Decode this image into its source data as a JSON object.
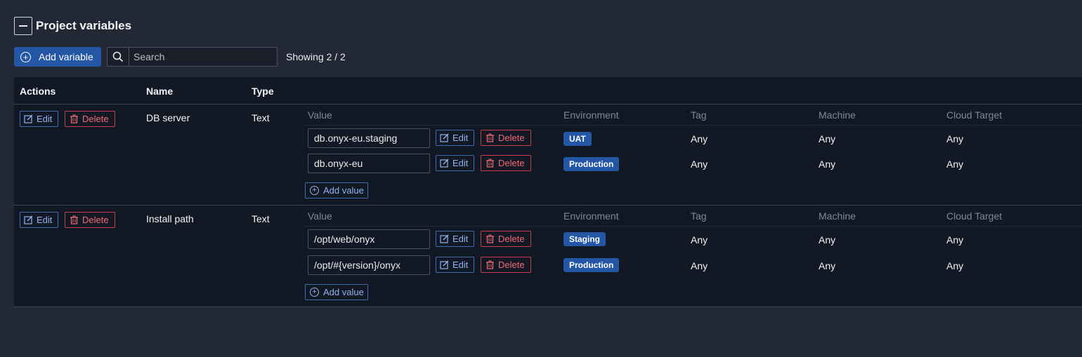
{
  "header": {
    "title": "Project variables"
  },
  "toolbar": {
    "add_variable_label": "Add variable",
    "search_placeholder": "Search",
    "showing": "Showing 2 / 2"
  },
  "table": {
    "columns": {
      "actions": "Actions",
      "name": "Name",
      "type": "Type"
    },
    "sub_columns": {
      "value": "Value",
      "environment": "Environment",
      "tag": "Tag",
      "machine": "Machine",
      "cloud_target": "Cloud Target"
    },
    "edit_label": "Edit",
    "delete_label": "Delete",
    "add_value_label": "Add value",
    "rows": [
      {
        "name": "DB server",
        "type": "Text",
        "values": [
          {
            "value": "db.onyx-eu.staging",
            "environment": "UAT",
            "tag": "Any",
            "machine": "Any",
            "cloud_target": "Any"
          },
          {
            "value": "db.onyx-eu",
            "environment": "Production",
            "tag": "Any",
            "machine": "Any",
            "cloud_target": "Any"
          }
        ]
      },
      {
        "name": "Install path",
        "type": "Text",
        "values": [
          {
            "value": "/opt/web/onyx",
            "environment": "Staging",
            "tag": "Any",
            "machine": "Any",
            "cloud_target": "Any"
          },
          {
            "value": "/opt/#{version}/onyx",
            "environment": "Production",
            "tag": "Any",
            "machine": "Any",
            "cloud_target": "Any"
          }
        ]
      }
    ]
  },
  "colors": {
    "background": "#222834",
    "table_background": "#131924",
    "primary": "#2456a6",
    "edit_border": "#3f6bb3",
    "delete_border": "#c0424f"
  }
}
